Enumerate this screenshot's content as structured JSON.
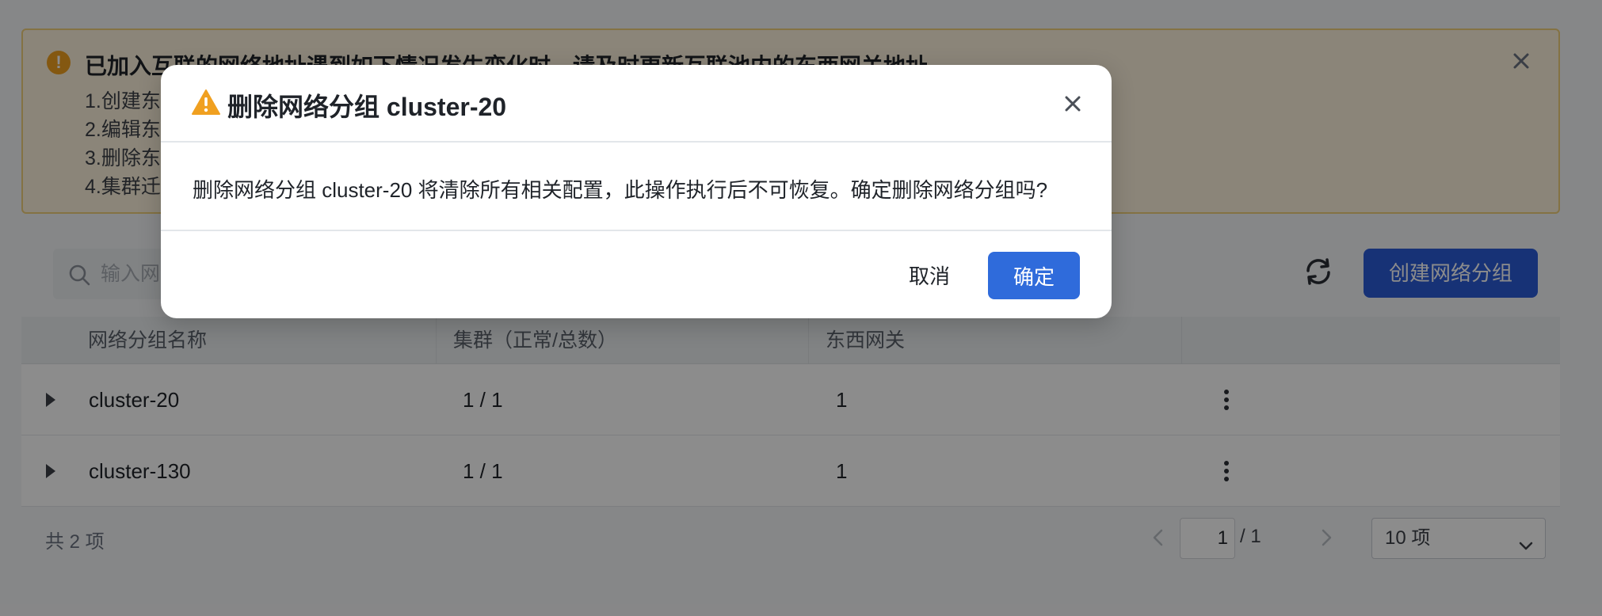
{
  "notice": {
    "title": "已加入互联的网络地址遇到如下情况发生变化时，请及时更新互联池内的东西网关地址",
    "lines": [
      "1.创建东",
      "2.编辑东",
      "3.删除东",
      "4.集群迁"
    ]
  },
  "toolbar": {
    "search_placeholder": "输入网络分组名称搜索",
    "create_label": "创建网络分组"
  },
  "table": {
    "headers": [
      "网络分组名称",
      "集群（正常/总数）",
      "东西网关",
      ""
    ],
    "rows": [
      {
        "name": "cluster-20",
        "clusters": "1 / 1",
        "gateways": "1"
      },
      {
        "name": "cluster-130",
        "clusters": "1 / 1",
        "gateways": "1"
      }
    ]
  },
  "footer": {
    "total": "共 2 项",
    "page_current": "1",
    "page_total": "/ 1",
    "page_size": "10 项"
  },
  "modal": {
    "title": "删除网络分组 cluster-20",
    "message": "删除网络分组 cluster-20 将清除所有相关配置，此操作执行后不可恢复。确定删除网络分组吗?",
    "cancel_label": "取消",
    "confirm_label": "确定"
  },
  "colors": {
    "primary": "#2f6bdb",
    "warning": "#f0a020",
    "overlay": "rgba(0,0,0,0.45)"
  }
}
